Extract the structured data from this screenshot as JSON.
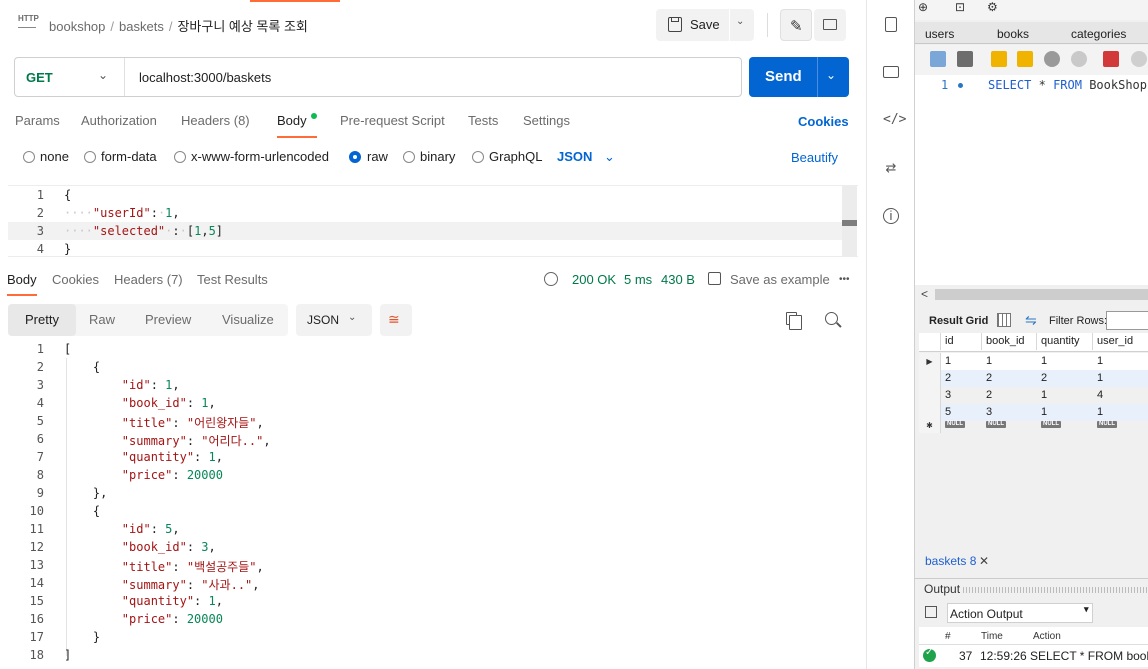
{
  "postman": {
    "breadcrumb": {
      "workspace": "bookshop",
      "collection": "baskets",
      "request": "장바구니 예상 목록 조회"
    },
    "save_label": "Save",
    "method": "GET",
    "url": "localhost:3000/baskets",
    "send_label": "Send",
    "request_tabs": [
      "Params",
      "Authorization",
      "Headers (8)",
      "Body",
      "Pre-request Script",
      "Tests",
      "Settings"
    ],
    "active_request_tab": "Body",
    "cookies_label": "Cookies",
    "body_types": [
      "none",
      "form-data",
      "x-www-form-urlencoded",
      "raw",
      "binary",
      "GraphQL"
    ],
    "selected_body_type": "raw",
    "body_format": "JSON",
    "beautify_label": "Beautify",
    "request_body_lines": [
      "1",
      "2",
      "3",
      "4"
    ],
    "response_tabs": [
      "Body",
      "Cookies",
      "Headers (7)",
      "Test Results"
    ],
    "active_response_tab": "Body",
    "status": "200 OK",
    "time": "5 ms",
    "size": "430 B",
    "save_example_label": "Save as example",
    "more_label": "•••",
    "view_modes": [
      "Pretty",
      "Raw",
      "Preview",
      "Visualize"
    ],
    "active_view_mode": "Pretty",
    "response_format": "JSON",
    "response_line_numbers": [
      "1",
      "2",
      "3",
      "4",
      "5",
      "6",
      "7",
      "8",
      "9",
      "10",
      "11",
      "12",
      "13",
      "14",
      "15",
      "16",
      "17",
      "18"
    ]
  },
  "request_body": {
    "userId": 1,
    "selected": [
      1,
      5
    ]
  },
  "response_body": [
    {
      "id": 1,
      "book_id": 1,
      "title": "어린왕자들",
      "summary": "어리다..",
      "quantity": 1,
      "price": 20000
    },
    {
      "id": 5,
      "book_id": 3,
      "title": "백설공주들",
      "summary": "사과..",
      "quantity": 1,
      "price": 20000
    }
  ],
  "workbench": {
    "table_tabs": [
      "users",
      "books",
      "categories"
    ],
    "sql_line_number": "1",
    "sql_keyword_select": "SELECT",
    "sql_star": "*",
    "sql_keyword_from": "FROM",
    "sql_table": "BookShop.",
    "result_grid_label": "Result Grid",
    "filter_rows_label": "Filter Rows:",
    "columns": [
      "id",
      "book_id",
      "quantity",
      "user_id"
    ],
    "rows": [
      [
        "1",
        "1",
        "1",
        "1"
      ],
      [
        "2",
        "2",
        "2",
        "1"
      ],
      [
        "3",
        "2",
        "1",
        "4"
      ],
      [
        "5",
        "3",
        "1",
        "1"
      ]
    ],
    "null_label": "NULL",
    "result_tab": "baskets 8",
    "output_label": "Output",
    "output_type": "Action Output",
    "output_columns": [
      "#",
      "Time",
      "Action"
    ],
    "output_row": {
      "num": "37",
      "time": "12:59:26",
      "action": "SELECT * FROM books l"
    }
  },
  "colors": {
    "send": "#0265d2",
    "method": "#00794a",
    "tab_underline": "#ff6c37",
    "status_ok": "#00794a"
  }
}
